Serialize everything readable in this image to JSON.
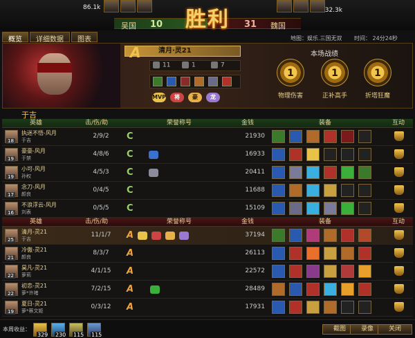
{
  "header": {
    "left_stat": "86.1k",
    "right_stat": "132.3k",
    "victory_text": "胜利",
    "team_left": "吴国",
    "kills_left": "10",
    "kills_right": "31",
    "team_right": "魏国"
  },
  "tabs": [
    "概览",
    "详细数据",
    "图表"
  ],
  "map_info": "地图：娱乐.三国无双",
  "time_info": "时间： 24分24秒",
  "hero_panel": {
    "rank": "A",
    "player_name": "清月·灵21",
    "kills": "11",
    "deaths": "1",
    "assists": "7",
    "battle_title": "本场战绩",
    "medals": [
      {
        "num": "1",
        "label": "物理伤害"
      },
      {
        "num": "1",
        "label": "正补高手"
      },
      {
        "num": "1",
        "label": "折塔狂魔"
      }
    ],
    "honor_badges": [
      "MVP",
      "将",
      "豪",
      "龙"
    ]
  },
  "team1_label": "于吉",
  "headers": {
    "hero": "英雄",
    "kda": "击/伤/助",
    "honor": "荣誉称号",
    "gold": "金钱",
    "items": "装备",
    "interact": "互动"
  },
  "team_green": [
    {
      "name": "执迷不悟-风月",
      "hero": "于吉",
      "level": "18",
      "kda": "2/9/2",
      "gold": "21930"
    },
    {
      "name": "豪豪-风月",
      "hero": "于禁",
      "level": "19",
      "kda": "4/8/6",
      "gold": "16933"
    },
    {
      "name": "小可-风月",
      "hero": "孙权",
      "level": "19",
      "kda": "4/5/3",
      "gold": "20411"
    },
    {
      "name": "念刀-风月",
      "hero": "颜良",
      "level": "17",
      "kda": "0/4/5",
      "gold": "11688"
    },
    {
      "name": "不浪浮云-风月",
      "hero": "刘表",
      "level": "16",
      "kda": "0/5/5",
      "gold": "15109"
    }
  ],
  "team_red": [
    {
      "name": "清月-灵21",
      "hero": "于吉",
      "level": "25",
      "kda": "11/1/7",
      "gold": "37194"
    },
    {
      "name": "冷傲-灵21",
      "hero": "颜良",
      "level": "21",
      "kda": "8/3/7",
      "gold": "26113"
    },
    {
      "name": "昊凡-灵21",
      "hero": "萝莉",
      "level": "22",
      "kda": "4/1/15",
      "gold": "22572"
    },
    {
      "name": "初恋-灵21",
      "hero": "萝*许褚",
      "level": "22",
      "kda": "7/2/15",
      "gold": "28489"
    },
    {
      "name": "夏日-灵21",
      "hero": "萝*蔡文姬",
      "level": "19",
      "kda": "0/3/12",
      "gold": "17931"
    }
  ],
  "bottom": {
    "label": "本周收益：",
    "resources": [
      "329",
      "230",
      "115",
      "115"
    ],
    "buttons": [
      "截图",
      "录像",
      "关闭"
    ]
  },
  "colors": {
    "gold": "#f0c24d",
    "green_team": "#1d3b18",
    "red_team": "#4a1414"
  }
}
